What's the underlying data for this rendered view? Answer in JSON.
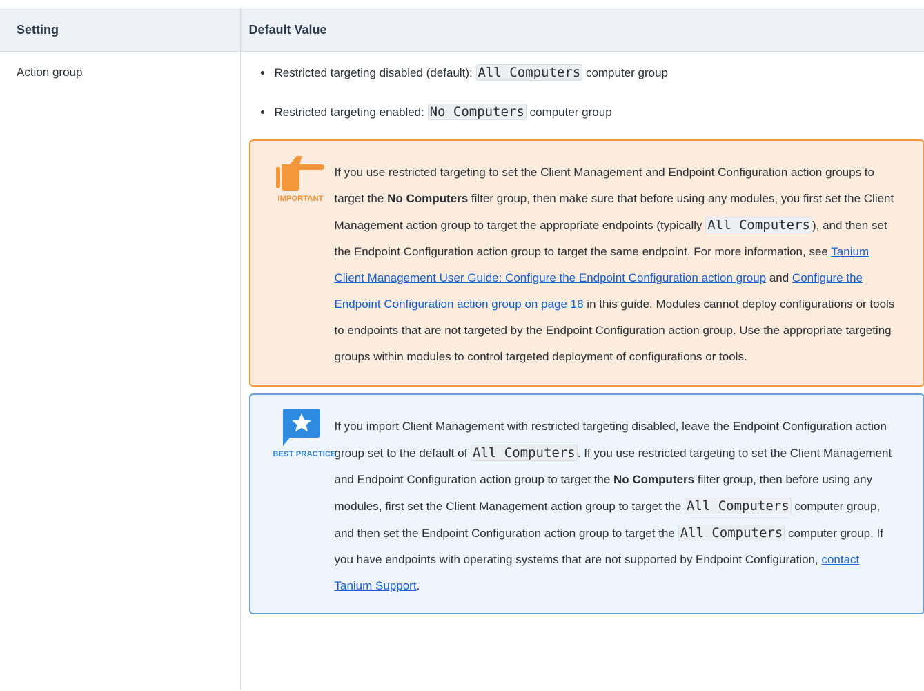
{
  "table": {
    "headers": {
      "setting": "Setting",
      "default_value": "Default Value"
    },
    "row": {
      "setting": "Action group",
      "defaults": [
        {
          "before": "Restricted targeting disabled (default): ",
          "code": "All Computers",
          "after": " computer group"
        },
        {
          "before": "Restricted targeting enabled: ",
          "code": "No Computers",
          "after": " computer group"
        }
      ]
    }
  },
  "important_note": {
    "tag": "IMPORTANT",
    "icon": "pointing-hand-icon",
    "color": "#f2973b",
    "t1": "If you use restricted targeting to set the Client Management and Endpoint Configuration action groups to target the ",
    "bold1": "No Computers",
    "t2": " filter group, then make sure that before using any modules, you first set the Client Management action group to target the appropriate endpoints (typically ",
    "code1": "All Computers",
    "t3": "), and then set the Endpoint Configuration action group to target the same endpoint. For more information, see ",
    "link1": "Tanium Client Management User Guide: Configure the Endpoint Configuration action group",
    "t4": " and ",
    "link2": "Configure the Endpoint Configuration action group on page 18",
    "t5": " in this guide. Modules cannot deploy configurations or tools to endpoints that are not targeted by the Endpoint Configuration action group. Use the appropriate targeting groups within modules to control targeted deployment of configurations or tools."
  },
  "best_practice_note": {
    "tag": "BEST PRACTICE",
    "icon": "star-speech-bubble-icon",
    "color": "#2e7fd4",
    "t1": "If you import Client Management with restricted targeting disabled, leave the Endpoint Configuration action group set to the default of ",
    "code1": "All Computers",
    "t2": ". If you use restricted targeting to set the Client Management and Endpoint Configuration action group to target the ",
    "bold1": "No Computers",
    "t3": " filter group, then before using any modules, first set the Client Management action group to target the ",
    "code2": "All Computers",
    "t4": " computer group, and then set the Endpoint Configuration action group to target the ",
    "code3": "All Computers",
    "t5": " computer group. If you have endpoints with operating systems that are not supported by Endpoint Configuration, ",
    "link1": "contact Tanium Support",
    "t6": "."
  }
}
